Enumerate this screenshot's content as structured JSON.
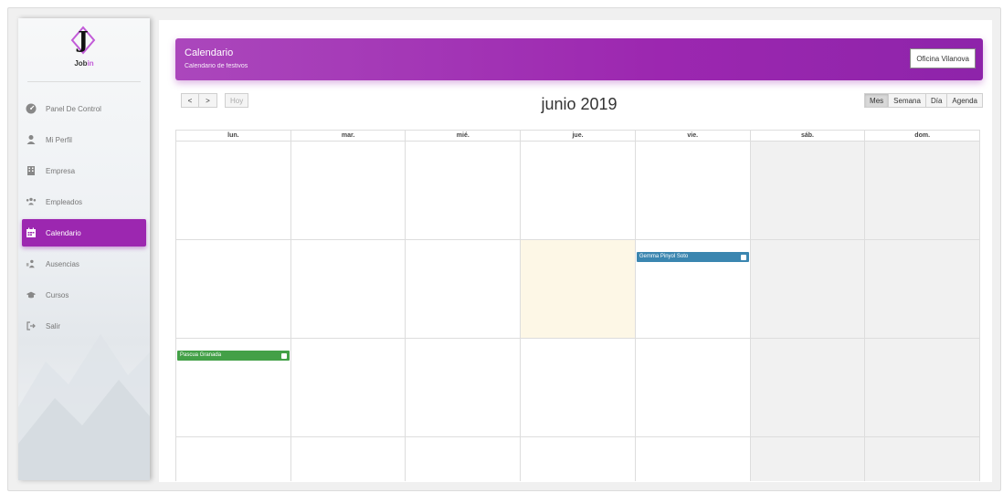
{
  "sidebar": {
    "brand_prefix": "Job",
    "brand_suffix": "in",
    "items": [
      {
        "label": "Panel De Control",
        "icon": "dashboard-icon"
      },
      {
        "label": "Mi Perfil",
        "icon": "user-icon"
      },
      {
        "label": "Empresa",
        "icon": "building-icon"
      },
      {
        "label": "Empleados",
        "icon": "people-icon"
      },
      {
        "label": "Calendario",
        "icon": "calendar-icon"
      },
      {
        "label": "Ausencias",
        "icon": "absences-icon"
      },
      {
        "label": "Cursos",
        "icon": "graduation-cap-icon"
      },
      {
        "label": "Salir",
        "icon": "logout-icon"
      }
    ],
    "active_index": 4
  },
  "header": {
    "title": "Calendario",
    "subtitle": "Calendario de festivos",
    "office": "Oficina Vilanova"
  },
  "toolbar": {
    "prev": "<",
    "next": ">",
    "today": "Hoy",
    "title": "junio 2019",
    "views": [
      "Mes",
      "Semana",
      "Día",
      "Agenda"
    ],
    "active_view": "Mes"
  },
  "calendar": {
    "weekdays": [
      "lun.",
      "mar.",
      "mié.",
      "jue.",
      "vie.",
      "sáb.",
      "dom."
    ],
    "weeks": 4,
    "today": {
      "week": 1,
      "day": 3
    },
    "events": [
      {
        "title": "Gemma Pinyol Soto",
        "week": 1,
        "day": 4,
        "color": "#3b86b0"
      },
      {
        "title": "Pascua Granada",
        "week": 2,
        "day": 0,
        "color": "#43a047"
      }
    ]
  },
  "colors": {
    "accent": "#9c27b0",
    "today_bg": "#fdf7e6",
    "weekend_bg": "#f1f1f1"
  }
}
